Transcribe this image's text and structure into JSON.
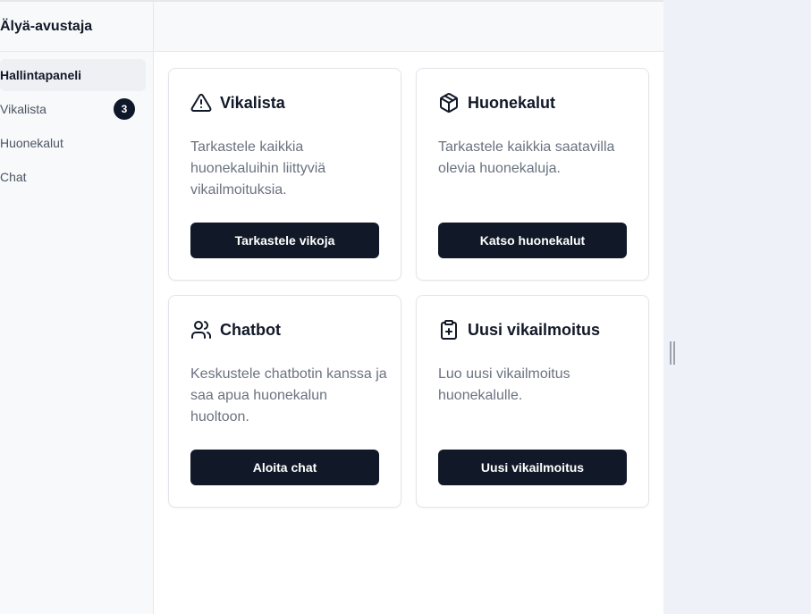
{
  "sidebar": {
    "title": "Älyä-avustaja",
    "items": [
      {
        "label": "Hallintapaneli",
        "active": true
      },
      {
        "label": "Vikalista",
        "badge": "3"
      },
      {
        "label": "Huonekalut"
      },
      {
        "label": "Chat"
      }
    ]
  },
  "cards": [
    {
      "icon": "warning-triangle-icon",
      "title": "Vikalista",
      "description": "Tarkastele kaikkia huonekaluihin liittyviä vikailmoituksia.",
      "button": "Tarkastele vikoja"
    },
    {
      "icon": "box-icon",
      "title": "Huonekalut",
      "description": "Tarkastele kaikkia saatavilla olevia huonekaluja.",
      "button": "Katso huonekalut"
    },
    {
      "icon": "users-icon",
      "title": "Chatbot",
      "description": "Keskustele chatbotin kanssa ja saa apua huonekalun huoltoon.",
      "button": "Aloita chat"
    },
    {
      "icon": "clipboard-plus-icon",
      "title": "Uusi vikailmoitus",
      "description": "Luo uusi vikailmoitus huonekalulle.",
      "button": "Uusi vikailmoitus"
    }
  ],
  "colors": {
    "button_bg": "#111827",
    "sidebar_bg": "#f8f9fb",
    "page_bg": "#eef1f8"
  }
}
